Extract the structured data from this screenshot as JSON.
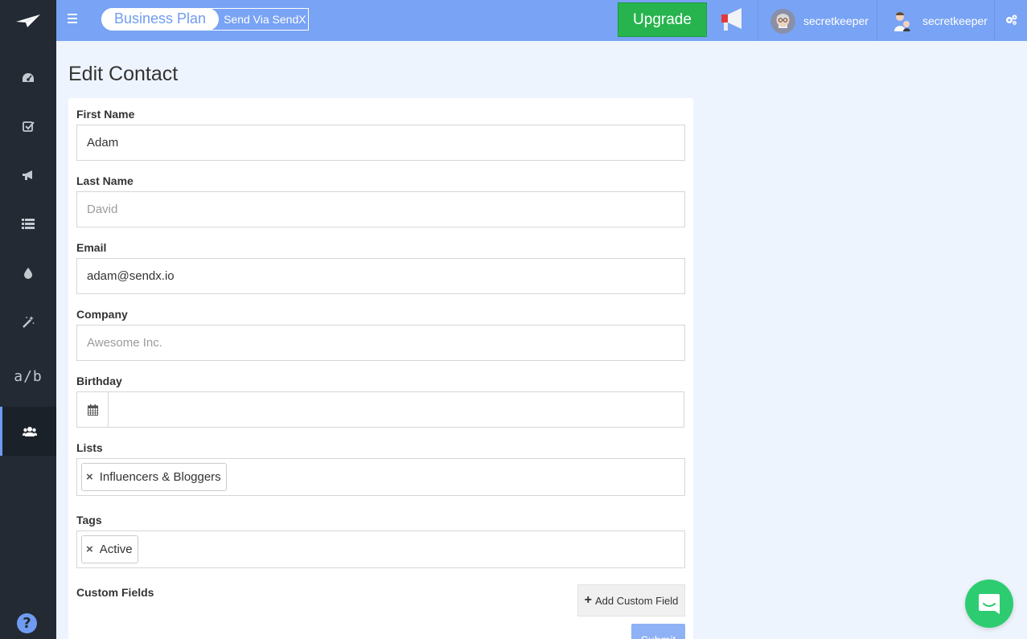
{
  "topbar": {
    "plan_label": "Business Plan",
    "send_label": "Send Via SendX",
    "upgrade_label": "Upgrade",
    "users": [
      {
        "name": "secretkeeper"
      },
      {
        "name": "secretkeeper"
      }
    ]
  },
  "sidebar": {
    "items": [
      {
        "icon": "dashboard-icon"
      },
      {
        "icon": "checklist-icon"
      },
      {
        "icon": "megaphone-icon"
      },
      {
        "icon": "list-icon"
      },
      {
        "icon": "drop-icon"
      },
      {
        "icon": "magic-wand-icon"
      },
      {
        "icon": "ab-test-icon",
        "text": "a/b"
      },
      {
        "icon": "users-icon",
        "active": true
      }
    ],
    "help_glyph": "?"
  },
  "page": {
    "title": "Edit Contact"
  },
  "form": {
    "first_name": {
      "label": "First Name",
      "value": "Adam",
      "placeholder": ""
    },
    "last_name": {
      "label": "Last Name",
      "value": "",
      "placeholder": "David"
    },
    "email": {
      "label": "Email",
      "value": "adam@sendx.io",
      "placeholder": ""
    },
    "company": {
      "label": "Company",
      "value": "",
      "placeholder": "Awesome Inc."
    },
    "birthday": {
      "label": "Birthday",
      "value": ""
    },
    "lists": {
      "label": "Lists",
      "chips": [
        "Influencers & Bloggers"
      ]
    },
    "tags": {
      "label": "Tags",
      "chips": [
        "Active"
      ]
    },
    "custom_fields": {
      "label": "Custom Fields",
      "add_label": "Add Custom Field"
    },
    "submit_label": "Submit"
  },
  "colors": {
    "topbar": "#79a3f4",
    "sidebar": "#232a33",
    "upgrade": "#27b44e",
    "chat": "#2ecc71",
    "accent": "#6f9cf2"
  }
}
